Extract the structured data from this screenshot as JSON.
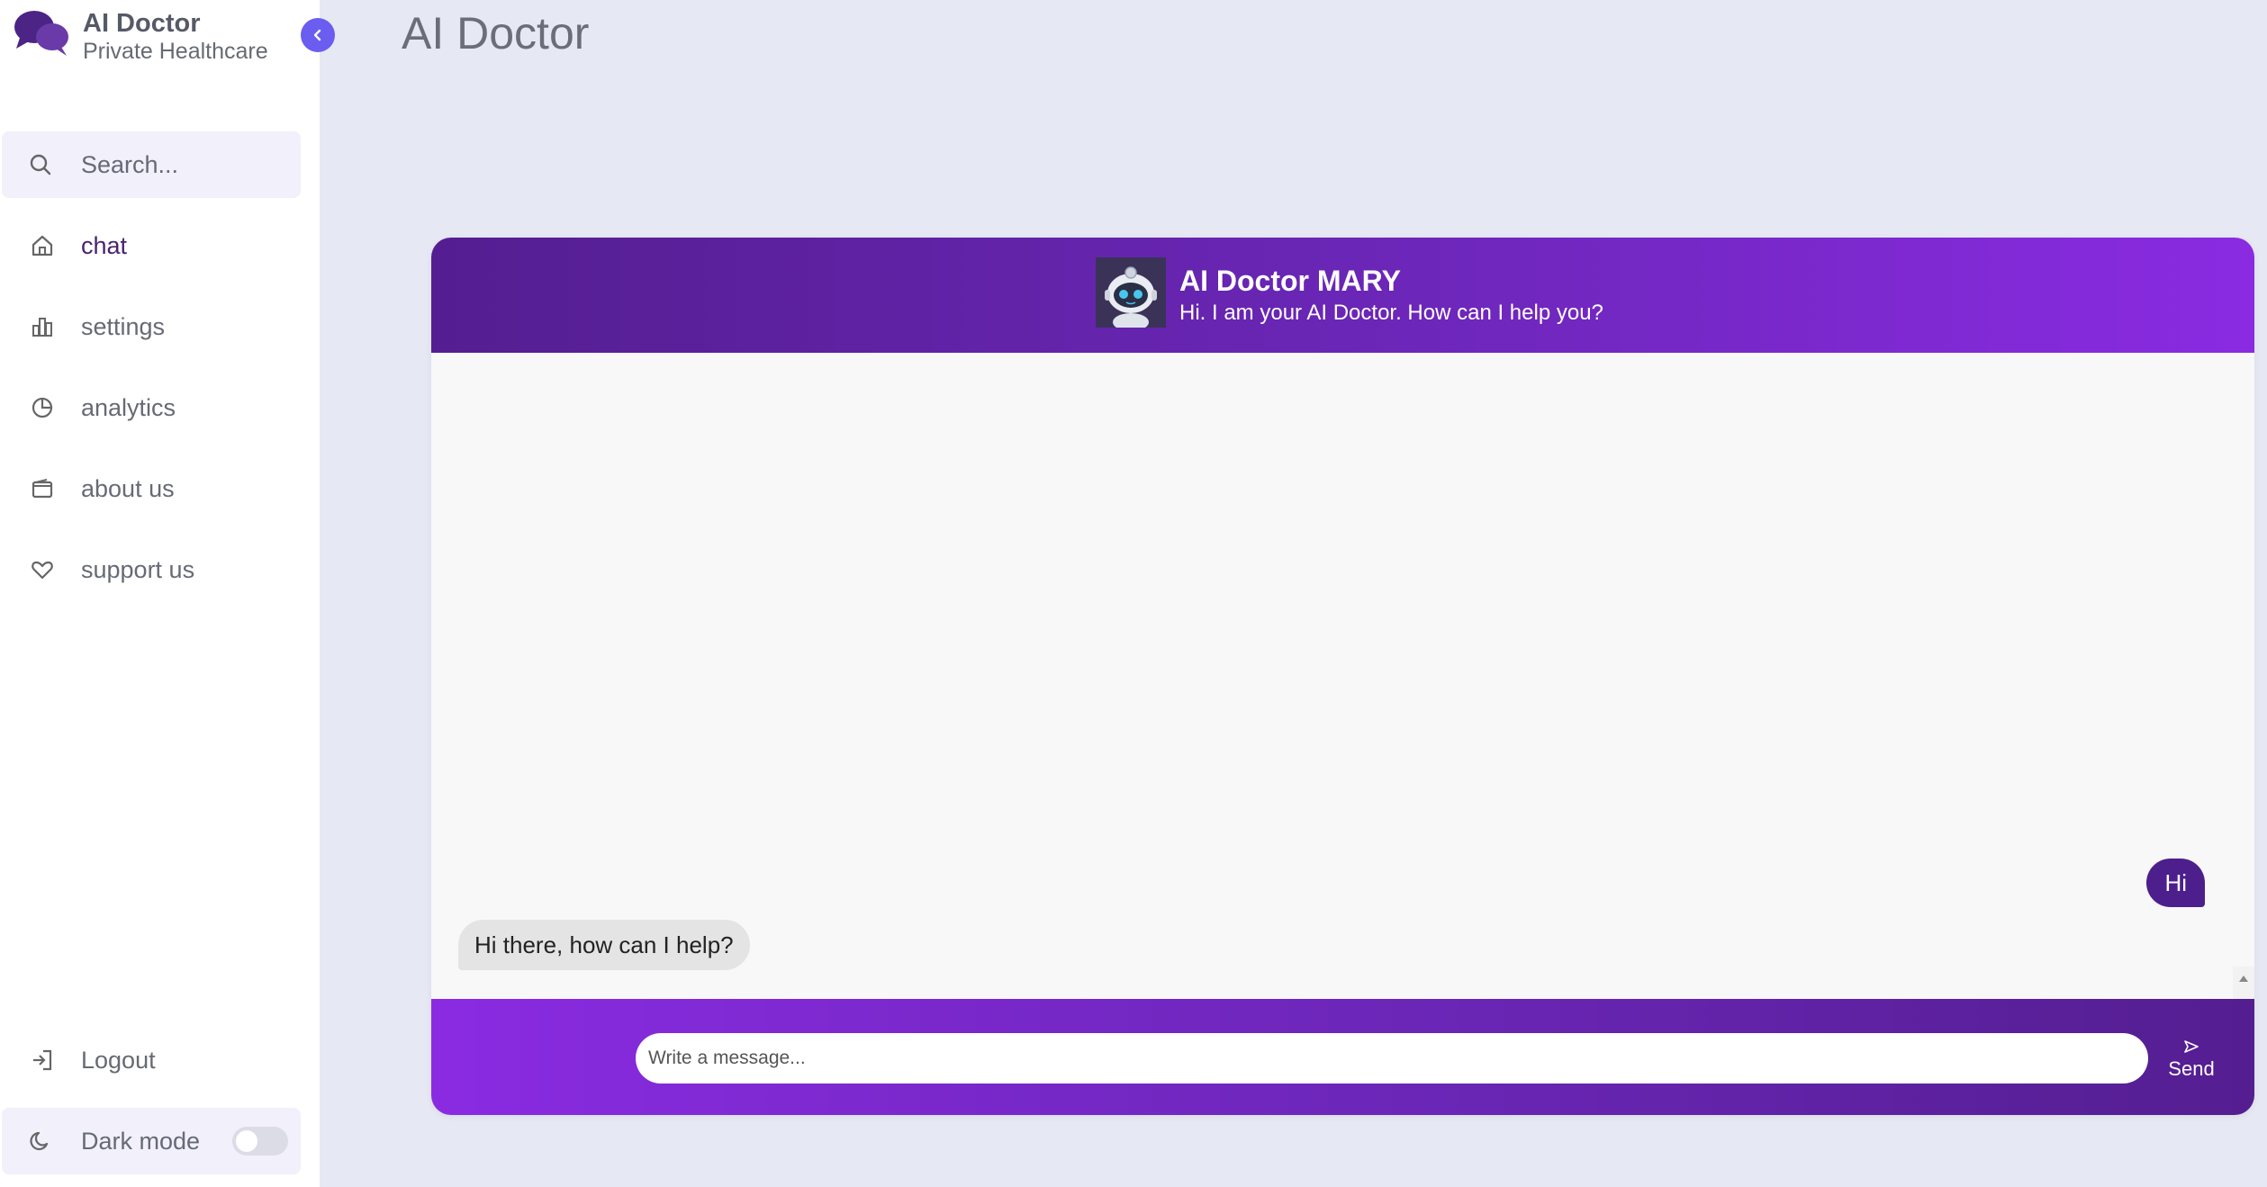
{
  "brand": {
    "title": "AI Doctor",
    "subtitle": "Private Healthcare",
    "logo_icon": "chat-bubbles-icon"
  },
  "sidebar": {
    "search_placeholder": "Search...",
    "items": [
      {
        "label": "chat",
        "icon": "home-icon",
        "active": true
      },
      {
        "label": "settings",
        "icon": "bar-chart-icon",
        "active": false
      },
      {
        "label": "analytics",
        "icon": "pie-chart-icon",
        "active": false
      },
      {
        "label": "about us",
        "icon": "wallet-icon",
        "active": false
      },
      {
        "label": "support us",
        "icon": "heart-icon",
        "active": false
      }
    ],
    "logout_label": "Logout",
    "dark_mode_label": "Dark mode",
    "dark_mode_enabled": false
  },
  "main": {
    "page_title": "AI Doctor"
  },
  "chat": {
    "bot_name": "AI Doctor MARY",
    "bot_greeting": "Hi. I am your AI Doctor. How can I help you?",
    "messages": [
      {
        "sender": "user",
        "text": "Hi"
      },
      {
        "sender": "bot",
        "text": "Hi there, how can I help?"
      }
    ],
    "input_placeholder": "Write a message...",
    "send_label": "Send"
  },
  "colors": {
    "accent": "#6a5df0",
    "header_dark": "#541e91",
    "header_light": "#8a2be2",
    "user_bubble": "#4d1f8c",
    "bot_bubble": "#e4e4e4",
    "page_bg": "#e6e8f4"
  }
}
